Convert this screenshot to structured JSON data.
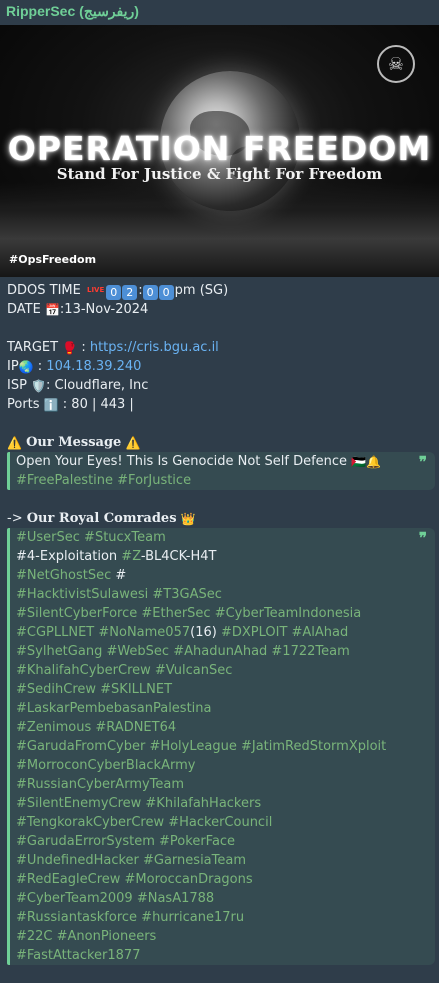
{
  "sender": {
    "name": "RipperSec (ريفرسيج)"
  },
  "banner": {
    "title": "OPERATION FREEDOM",
    "subtitle": "Stand For Justice & Fight For Freedom",
    "hashtag": "#OpsFreedom"
  },
  "details": {
    "ddos_label": "DDOS TIME",
    "live_badge": "LIVE",
    "time_digits": [
      "0",
      "2",
      "0",
      "0"
    ],
    "time_suffix": "pm (SG)",
    "date_label": "DATE",
    "date_value": ":13-Nov-2024",
    "target_label": "TARGET",
    "target_url": "https://cris.bgu.ac.il",
    "ip_label": "IP",
    "ip_value": "104.18.39.240",
    "isp_label": "ISP",
    "isp_value": ": Cloudflare, Inc",
    "ports_label": "Ports",
    "ports_value": ": 80 | 443 |"
  },
  "message": {
    "heading": "Our Message",
    "text": "Open Your Eyes! This Is Genocide Not Self Defence",
    "tags": "#FreePalestine #ForJustice"
  },
  "comrades": {
    "heading_prefix": "->",
    "heading": "Our Royal Comrades",
    "lines": [
      "#UserSec #StucxTeam",
      "#4-Exploitation #Z-BL4CK-H4T",
      "#NetGhostSec #",
      "#HacktivistSulawesi #T3GASec",
      "#SilentCyberForce #EtherSec #CyberTeamIndonesia",
      "#CGPLLNET #NoName057(16) #DXPLOIT #AlAhad",
      "#SylhetGang #WebSec #AhadunAhad #1722Team",
      "#KhalifahCyberCrew #VulcanSec",
      "#SedihCrew #SKILLNET",
      "#LaskarPembebasanPalestina",
      "#Zenimous #RADNET64",
      "#GarudaFromCyber #HolyLeague  #JatimRedStormXploit",
      "#MorroconCyberBlackArmy",
      "#RussianCyberArmyTeam",
      "#SilentEnemyCrew #KhilafahHackers",
      "#TengkorakCyberCrew #HackerCouncil",
      "#GarudaErrorSystem #PokerFace",
      "#UndefinedHacker #GarnesiaTeam",
      "#RedEagleCrew #MoroccanDragons",
      "#CyberTeam2009 #NasA1788",
      "#Russiantaskforce #hurricane17ru",
      "#22C #AnonPioneers",
      "#FastAttacker1877"
    ]
  },
  "icons": {
    "warning": "⚠️",
    "crown": "👑",
    "calendar": "📅",
    "boxing_glove": "🥊",
    "globe": "🌏",
    "shield": "🛡️",
    "info": "ℹ️",
    "flag": "🇵🇸",
    "bell": "🔔",
    "quote": "❞"
  },
  "colors": {
    "accent": "#6fcf97",
    "link": "#6ab3f3",
    "hashtag": "#79b47a",
    "bubble": "#2f3d4a"
  }
}
